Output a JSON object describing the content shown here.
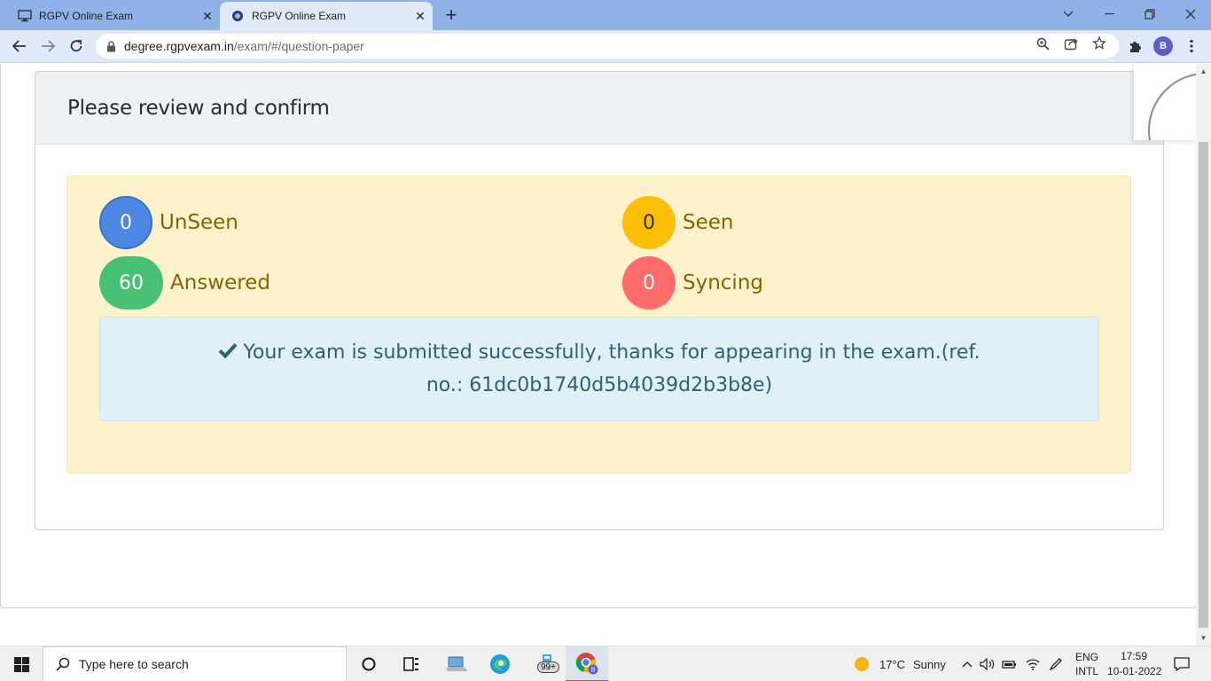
{
  "browser": {
    "tabs": [
      {
        "title": "RGPV Online Exam",
        "active": false
      },
      {
        "title": "RGPV Online Exam",
        "active": true
      }
    ],
    "new_tab": "+",
    "close": "✕",
    "url_host": "degree.rgpvexam.in",
    "url_path": "/exam/#/question-paper",
    "profile_initial": "B"
  },
  "page": {
    "header_title": "Please review and confirm",
    "stats": [
      {
        "key": "unseen",
        "count": "0",
        "label": "UnSeen",
        "color": "#4d88e4"
      },
      {
        "key": "seen",
        "count": "0",
        "label": "Seen",
        "color": "#fdbe08"
      },
      {
        "key": "answered",
        "count": "60",
        "label": "Answered",
        "color": "#48c177"
      },
      {
        "key": "syncing",
        "count": "0",
        "label": "Syncing",
        "color": "#fe6c6c"
      }
    ],
    "success_message": "Your exam is submitted successfully, thanks for appearing in the exam.(ref. no.: 61dc0b1740d5b4039d2b3b8e)"
  },
  "taskbar": {
    "search_placeholder": "Type here to search",
    "badge": "99+",
    "weather_temp": "17°C",
    "weather_desc": "Sunny",
    "language_line1": "ENG",
    "language_line2": "INTL",
    "time": "17:59",
    "date": "10-01-2022"
  },
  "colors": {
    "tabstrip": "#8fb3e8",
    "toolbar": "#dfe9f8",
    "summary_bg": "#fef2cc",
    "alert_bg": "#dff0f6"
  }
}
